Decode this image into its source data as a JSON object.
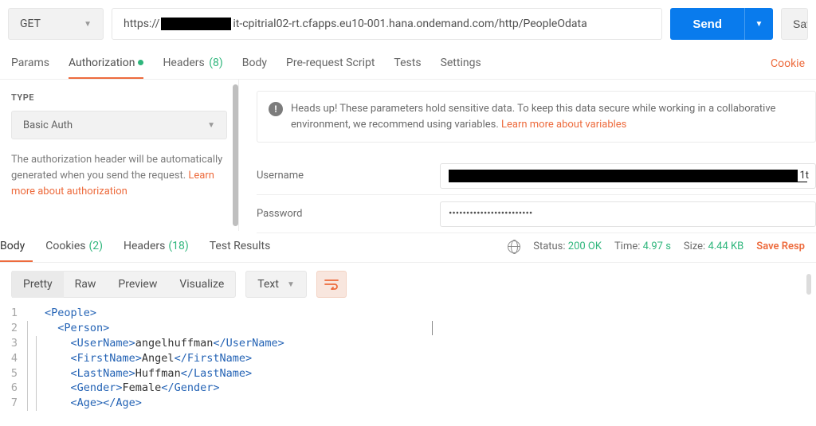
{
  "request": {
    "method": "GET",
    "url_prefix": "https://",
    "url_suffix": "it-cpitrial02-rt.cfapps.eu10-001.hana.ondemand.com/http/PeopleOdata",
    "send_label": "Send",
    "save_label": "Sav"
  },
  "req_tabs": {
    "params": "Params",
    "authorization": "Authorization",
    "headers": "Headers",
    "headers_count": "(8)",
    "body": "Body",
    "prerequest": "Pre-request Script",
    "tests": "Tests",
    "settings": "Settings",
    "cookies_link": "Cookie"
  },
  "auth": {
    "type_label": "TYPE",
    "type_value": "Basic Auth",
    "desc_1": "The authorization header will be automatically generated when you send the request. ",
    "desc_link": "Learn more about authorization",
    "notice_1": "Heads up! These parameters hold sensitive data. To keep this data secure while working in a collaborative environment, we recommend using variables. ",
    "notice_link": "Learn more about variables",
    "username_label": "Username",
    "username_tail": "1t",
    "password_label": "Password",
    "password_value": "••••••••••••••••••••••••"
  },
  "resp_tabs": {
    "body": "Body",
    "cookies": "Cookies",
    "cookies_count": "(2)",
    "headers": "Headers",
    "headers_count": "(18)",
    "tests": "Test Results"
  },
  "resp_meta": {
    "status_label": "Status:",
    "status_value": "200 OK",
    "time_label": "Time:",
    "time_value": "4.97 s",
    "size_label": "Size:",
    "size_value": "4.44 KB",
    "save": "Save Resp"
  },
  "body_view": {
    "pretty": "Pretty",
    "raw": "Raw",
    "preview": "Preview",
    "visualize": "Visualize",
    "format": "Text"
  },
  "code_lines": [
    {
      "n": "1",
      "indent": 0,
      "open": "<People>",
      "val": "",
      "close": ""
    },
    {
      "n": "2",
      "indent": 1,
      "open": "<Person>",
      "val": "",
      "close": ""
    },
    {
      "n": "3",
      "indent": 2,
      "open": "<UserName>",
      "val": "angelhuffman",
      "close": "</UserName>"
    },
    {
      "n": "4",
      "indent": 2,
      "open": "<FirstName>",
      "val": "Angel",
      "close": "</FirstName>"
    },
    {
      "n": "5",
      "indent": 2,
      "open": "<LastName>",
      "val": "Huffman",
      "close": "</LastName>"
    },
    {
      "n": "6",
      "indent": 2,
      "open": "<Gender>",
      "val": "Female",
      "close": "</Gender>"
    },
    {
      "n": "7",
      "indent": 2,
      "open": "<Age>",
      "val": "",
      "close": "</Age>"
    }
  ]
}
